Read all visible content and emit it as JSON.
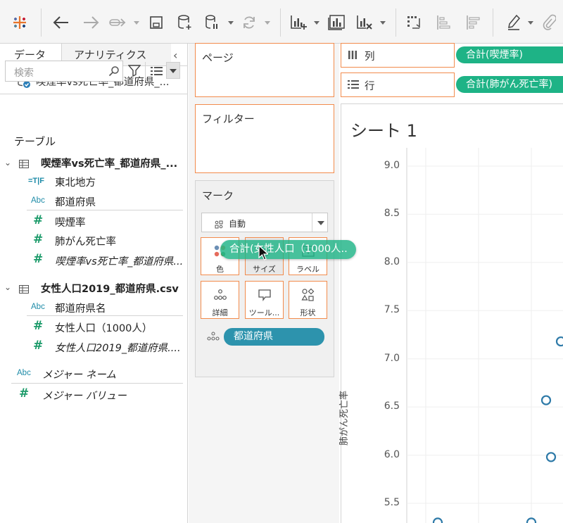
{
  "left_pane": {
    "tabs": [
      "データ",
      "アナリティクス"
    ],
    "collapse_glyph": "‹",
    "datasource": "喫煙率vs死亡率_都道府県_...",
    "search_placeholder": "検索",
    "section_title": "テーブル",
    "tables": [
      {
        "name": "喫煙率vs死亡率_都道府県_...",
        "fields": [
          {
            "icon": "boolean-icon",
            "icon_text": "=T|F",
            "label": "東北地方"
          },
          {
            "icon": "string-icon",
            "icon_text": "Abc",
            "label": "都道府県"
          },
          {
            "icon": "number-icon",
            "icon_text": "#",
            "label": "喫煙率"
          },
          {
            "icon": "number-icon",
            "icon_text": "#",
            "label": "肺がん死亡率"
          },
          {
            "icon": "number-icon",
            "icon_text": "#",
            "label": "喫煙率vs死亡率_都道府県..."
          }
        ]
      },
      {
        "name": "女性人口2019_都道府県.csv",
        "fields": [
          {
            "icon": "string-icon",
            "icon_text": "Abc",
            "label": "都道府県名"
          },
          {
            "icon": "number-icon",
            "icon_text": "#",
            "label": "女性人口（1000人）"
          },
          {
            "icon": "number-icon",
            "icon_text": "#",
            "label": "女性人口2019_都道府県...."
          }
        ]
      }
    ],
    "measure_names": {
      "icon_text": "Abc",
      "label": "メジャー ネーム"
    },
    "measure_values": {
      "icon_text": "#",
      "label": "メジャー バリュー"
    }
  },
  "cards": {
    "pages": "ページ",
    "filters": "フィルター",
    "marks": {
      "title": "マーク",
      "type": "自動",
      "buttons": [
        "色",
        "サイズ",
        "ラベル",
        "詳細",
        "ツール...",
        "形状"
      ],
      "detail_pill": "都道府県"
    }
  },
  "shelves": {
    "columns": {
      "label": "列",
      "pill": "合計(喫煙率)"
    },
    "rows": {
      "label": "行",
      "pill": "合計(肺がん死亡率)"
    }
  },
  "viz": {
    "sheet_title": "シート 1",
    "y_axis_title": "肺がん死亡率"
  },
  "drag_pill": "合計(女性人口（1000人..",
  "chart_data": {
    "type": "scatter",
    "title": "シート 1",
    "xlabel": "",
    "ylabel": "肺がん死亡率",
    "yticks": [
      "9.0",
      "8.5",
      "8.0",
      "7.5",
      "7.0",
      "6.5",
      "6.0",
      "5.5"
    ],
    "ylim": [
      5.4,
      9.1
    ],
    "points_visible_y": [
      7.18,
      6.57,
      5.98,
      5.3,
      5.3
    ]
  },
  "colors": {
    "accent_orange": "#f28b4c",
    "pill_green": "#1eb386",
    "pill_blue": "#2d93ad",
    "mark_stroke": "#2e7aa8"
  }
}
